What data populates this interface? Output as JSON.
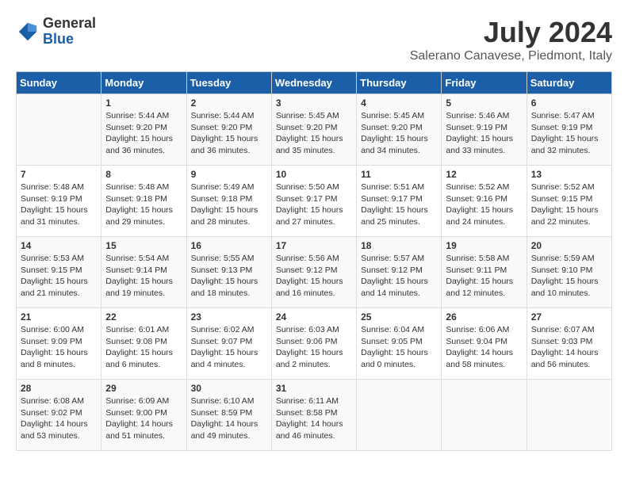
{
  "logo": {
    "general": "General",
    "blue": "Blue"
  },
  "title": "July 2024",
  "location": "Salerano Canavese, Piedmont, Italy",
  "days_of_week": [
    "Sunday",
    "Monday",
    "Tuesday",
    "Wednesday",
    "Thursday",
    "Friday",
    "Saturday"
  ],
  "weeks": [
    [
      {
        "day": null,
        "content": ""
      },
      {
        "day": "1",
        "content": "Sunrise: 5:44 AM\nSunset: 9:20 PM\nDaylight: 15 hours\nand 36 minutes."
      },
      {
        "day": "2",
        "content": "Sunrise: 5:44 AM\nSunset: 9:20 PM\nDaylight: 15 hours\nand 36 minutes."
      },
      {
        "day": "3",
        "content": "Sunrise: 5:45 AM\nSunset: 9:20 PM\nDaylight: 15 hours\nand 35 minutes."
      },
      {
        "day": "4",
        "content": "Sunrise: 5:45 AM\nSunset: 9:20 PM\nDaylight: 15 hours\nand 34 minutes."
      },
      {
        "day": "5",
        "content": "Sunrise: 5:46 AM\nSunset: 9:19 PM\nDaylight: 15 hours\nand 33 minutes."
      },
      {
        "day": "6",
        "content": "Sunrise: 5:47 AM\nSunset: 9:19 PM\nDaylight: 15 hours\nand 32 minutes."
      }
    ],
    [
      {
        "day": "7",
        "content": "Sunrise: 5:48 AM\nSunset: 9:19 PM\nDaylight: 15 hours\nand 31 minutes."
      },
      {
        "day": "8",
        "content": "Sunrise: 5:48 AM\nSunset: 9:18 PM\nDaylight: 15 hours\nand 29 minutes."
      },
      {
        "day": "9",
        "content": "Sunrise: 5:49 AM\nSunset: 9:18 PM\nDaylight: 15 hours\nand 28 minutes."
      },
      {
        "day": "10",
        "content": "Sunrise: 5:50 AM\nSunset: 9:17 PM\nDaylight: 15 hours\nand 27 minutes."
      },
      {
        "day": "11",
        "content": "Sunrise: 5:51 AM\nSunset: 9:17 PM\nDaylight: 15 hours\nand 25 minutes."
      },
      {
        "day": "12",
        "content": "Sunrise: 5:52 AM\nSunset: 9:16 PM\nDaylight: 15 hours\nand 24 minutes."
      },
      {
        "day": "13",
        "content": "Sunrise: 5:52 AM\nSunset: 9:15 PM\nDaylight: 15 hours\nand 22 minutes."
      }
    ],
    [
      {
        "day": "14",
        "content": "Sunrise: 5:53 AM\nSunset: 9:15 PM\nDaylight: 15 hours\nand 21 minutes."
      },
      {
        "day": "15",
        "content": "Sunrise: 5:54 AM\nSunset: 9:14 PM\nDaylight: 15 hours\nand 19 minutes."
      },
      {
        "day": "16",
        "content": "Sunrise: 5:55 AM\nSunset: 9:13 PM\nDaylight: 15 hours\nand 18 minutes."
      },
      {
        "day": "17",
        "content": "Sunrise: 5:56 AM\nSunset: 9:12 PM\nDaylight: 15 hours\nand 16 minutes."
      },
      {
        "day": "18",
        "content": "Sunrise: 5:57 AM\nSunset: 9:12 PM\nDaylight: 15 hours\nand 14 minutes."
      },
      {
        "day": "19",
        "content": "Sunrise: 5:58 AM\nSunset: 9:11 PM\nDaylight: 15 hours\nand 12 minutes."
      },
      {
        "day": "20",
        "content": "Sunrise: 5:59 AM\nSunset: 9:10 PM\nDaylight: 15 hours\nand 10 minutes."
      }
    ],
    [
      {
        "day": "21",
        "content": "Sunrise: 6:00 AM\nSunset: 9:09 PM\nDaylight: 15 hours\nand 8 minutes."
      },
      {
        "day": "22",
        "content": "Sunrise: 6:01 AM\nSunset: 9:08 PM\nDaylight: 15 hours\nand 6 minutes."
      },
      {
        "day": "23",
        "content": "Sunrise: 6:02 AM\nSunset: 9:07 PM\nDaylight: 15 hours\nand 4 minutes."
      },
      {
        "day": "24",
        "content": "Sunrise: 6:03 AM\nSunset: 9:06 PM\nDaylight: 15 hours\nand 2 minutes."
      },
      {
        "day": "25",
        "content": "Sunrise: 6:04 AM\nSunset: 9:05 PM\nDaylight: 15 hours\nand 0 minutes."
      },
      {
        "day": "26",
        "content": "Sunrise: 6:06 AM\nSunset: 9:04 PM\nDaylight: 14 hours\nand 58 minutes."
      },
      {
        "day": "27",
        "content": "Sunrise: 6:07 AM\nSunset: 9:03 PM\nDaylight: 14 hours\nand 56 minutes."
      }
    ],
    [
      {
        "day": "28",
        "content": "Sunrise: 6:08 AM\nSunset: 9:02 PM\nDaylight: 14 hours\nand 53 minutes."
      },
      {
        "day": "29",
        "content": "Sunrise: 6:09 AM\nSunset: 9:00 PM\nDaylight: 14 hours\nand 51 minutes."
      },
      {
        "day": "30",
        "content": "Sunrise: 6:10 AM\nSunset: 8:59 PM\nDaylight: 14 hours\nand 49 minutes."
      },
      {
        "day": "31",
        "content": "Sunrise: 6:11 AM\nSunset: 8:58 PM\nDaylight: 14 hours\nand 46 minutes."
      },
      {
        "day": null,
        "content": ""
      },
      {
        "day": null,
        "content": ""
      },
      {
        "day": null,
        "content": ""
      }
    ]
  ]
}
